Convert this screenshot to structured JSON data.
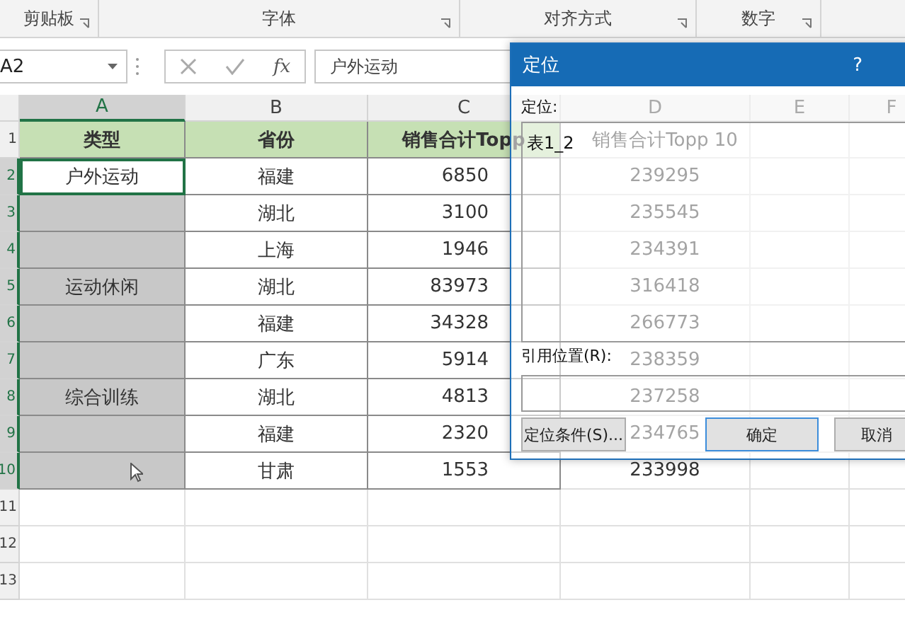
{
  "ribbon": {
    "groups": [
      {
        "label": "剪贴板"
      },
      {
        "label": "字体"
      },
      {
        "label": "对齐方式"
      },
      {
        "label": "数字"
      }
    ]
  },
  "formula_bar": {
    "name_box": "A2",
    "function_label": "fx",
    "value": "户外运动"
  },
  "sheet": {
    "columns": [
      {
        "label": "A",
        "selected": true
      },
      {
        "label": "B",
        "selected": false
      },
      {
        "label": "C",
        "selected": false
      },
      {
        "label": "D",
        "selected": false
      },
      {
        "label": "E",
        "selected": false
      },
      {
        "label": "F",
        "selected": false
      }
    ],
    "rows": [
      {
        "number": "1",
        "kind": "header",
        "selected": false,
        "cells": [
          {
            "text": "类型"
          },
          {
            "text": "省份"
          },
          {
            "text": "销售合计Topp"
          },
          {
            "text": "销售合计Topp 10"
          }
        ]
      },
      {
        "number": "2",
        "kind": "data",
        "selected": true,
        "cells": [
          {
            "text": "户外运动",
            "selected": false
          },
          {
            "text": "福建"
          },
          {
            "text": "6850"
          },
          {
            "text": "239295"
          }
        ]
      },
      {
        "number": "3",
        "kind": "data",
        "selected": true,
        "cells": [
          {
            "selected": true
          },
          {
            "text": "湖北"
          },
          {
            "text": "3100"
          },
          {
            "text": "235545"
          }
        ]
      },
      {
        "number": "4",
        "kind": "data",
        "selected": true,
        "cells": [
          {
            "selected": true
          },
          {
            "text": "上海"
          },
          {
            "text": "1946"
          },
          {
            "text": "234391"
          }
        ]
      },
      {
        "number": "5",
        "kind": "data",
        "selected": true,
        "cells": [
          {
            "text": "运动休闲",
            "selected": true
          },
          {
            "text": "湖北"
          },
          {
            "text": "83973"
          },
          {
            "text": "316418"
          }
        ]
      },
      {
        "number": "6",
        "kind": "data",
        "selected": true,
        "cells": [
          {
            "selected": true
          },
          {
            "text": "福建"
          },
          {
            "text": "34328"
          },
          {
            "text": "266773"
          }
        ]
      },
      {
        "number": "7",
        "kind": "data",
        "selected": true,
        "cells": [
          {
            "selected": true
          },
          {
            "text": "广东"
          },
          {
            "text": "5914"
          },
          {
            "text": "238359"
          }
        ]
      },
      {
        "number": "8",
        "kind": "data",
        "selected": true,
        "cells": [
          {
            "text": "综合训练",
            "selected": true
          },
          {
            "text": "湖北"
          },
          {
            "text": "4813"
          },
          {
            "text": "237258"
          }
        ]
      },
      {
        "number": "9",
        "kind": "data",
        "selected": true,
        "cells": [
          {
            "selected": true
          },
          {
            "text": "福建"
          },
          {
            "text": "2320"
          },
          {
            "text": "234765"
          }
        ]
      },
      {
        "number": "10",
        "kind": "data",
        "selected": true,
        "cells": [
          {
            "selected": true
          },
          {
            "text": "甘肃"
          },
          {
            "text": "1553"
          },
          {
            "text": "233998"
          }
        ]
      },
      {
        "number": "11",
        "kind": "empty",
        "selected": false,
        "cells": []
      },
      {
        "number": "12",
        "kind": "empty",
        "selected": false,
        "cells": []
      },
      {
        "number": "13",
        "kind": "empty",
        "selected": false,
        "cells": []
      }
    ]
  },
  "dialog": {
    "title": "定位",
    "help": "?",
    "list_label": "定位:",
    "list_items": [
      {
        "text": "表1_2"
      }
    ],
    "reference_label": "引用位置(R):",
    "buttons": [
      {
        "label": "定位条件(S)...",
        "kind": "secondary"
      },
      {
        "label": "确定",
        "kind": "default"
      },
      {
        "label": "取消",
        "kind": "secondary"
      }
    ]
  }
}
